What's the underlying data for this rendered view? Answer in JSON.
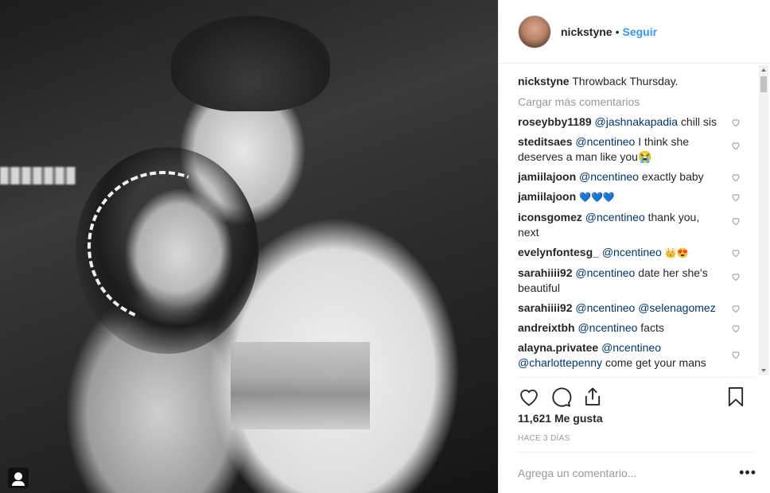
{
  "header": {
    "username": "nickstyne",
    "separator": "•",
    "follow_label": "Seguir"
  },
  "caption": {
    "username": "nickstyne",
    "text": "Throwback Thursday."
  },
  "load_more_label": "Cargar más comentarios",
  "comments": [
    {
      "user": "roseybby1189",
      "mention": "@jashnakapadia",
      "text": "chill sis"
    },
    {
      "user": "steditsaes",
      "mention": "@ncentineo",
      "text": "I think she deserves a man like you😭"
    },
    {
      "user": "jamiilajoon",
      "mention": "@ncentineo",
      "text": "exactly baby"
    },
    {
      "user": "jamiilajoon",
      "mention": "",
      "text": "💙💙💙"
    },
    {
      "user": "iconsgomez",
      "mention": "@ncentineo",
      "text": "thank you, next"
    },
    {
      "user": "evelynfontesg_",
      "mention": "@ncentineo",
      "text": "👑😍"
    },
    {
      "user": "sarahiiii92",
      "mention": "@ncentineo",
      "text": "date her she's beautiful"
    },
    {
      "user": "sarahiiii92",
      "mention": "@ncentineo @selenagomez",
      "text": ""
    },
    {
      "user": "andreixtbh",
      "mention": "@ncentineo",
      "text": "facts"
    },
    {
      "user": "alayna.privatee",
      "mention": "@ncentineo @charlottepenny",
      "text": "come get your mans"
    }
  ],
  "likes_label": "11,621 Me gusta",
  "date_label": "HACE 3 DÍAS",
  "add_comment_placeholder": "Agrega un comentario...",
  "more_options_label": "•••",
  "icons": {
    "like": "heart-icon",
    "comment": "comment-icon",
    "share": "share-icon",
    "save": "bookmark-icon",
    "user_tag": "user-tag-icon"
  }
}
